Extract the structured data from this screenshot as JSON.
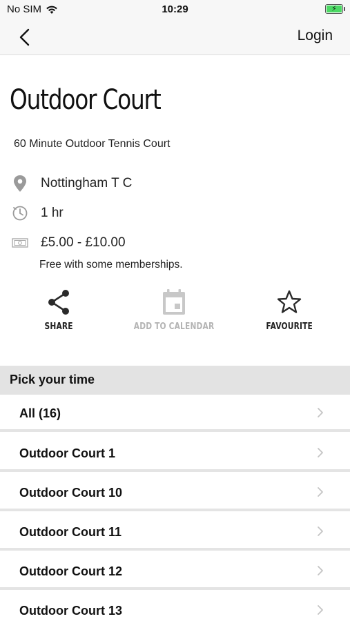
{
  "status_bar": {
    "carrier": "No SIM",
    "time": "10:29"
  },
  "nav": {
    "login_label": "Login"
  },
  "header": {
    "title": "Outdoor Court",
    "subtitle": "60 Minute Outdoor Tennis Court"
  },
  "info": {
    "location": "Nottingham T C",
    "duration": "1 hr",
    "price": "£5.00 - £10.00",
    "note": "Free with some memberships."
  },
  "actions": {
    "share_label": "SHARE",
    "calendar_label": "ADD TO CALENDAR",
    "favourite_label": "FAVOURITE"
  },
  "section": {
    "title": "Pick your time"
  },
  "list": [
    {
      "label": "All (16)"
    },
    {
      "label": "Outdoor Court 1"
    },
    {
      "label": "Outdoor Court 10"
    },
    {
      "label": "Outdoor Court 11"
    },
    {
      "label": "Outdoor Court 12"
    },
    {
      "label": "Outdoor Court 13"
    }
  ],
  "colors": {
    "accent_disabled": "#b4b4b4",
    "section_bg": "#e3e3e3",
    "battery": "#4cd964"
  },
  "icons": [
    "back-chevron-icon",
    "wifi-icon",
    "battery-icon",
    "location-pin-icon",
    "clock-icon",
    "money-icon",
    "share-icon",
    "calendar-icon",
    "star-icon",
    "chevron-right-icon"
  ]
}
